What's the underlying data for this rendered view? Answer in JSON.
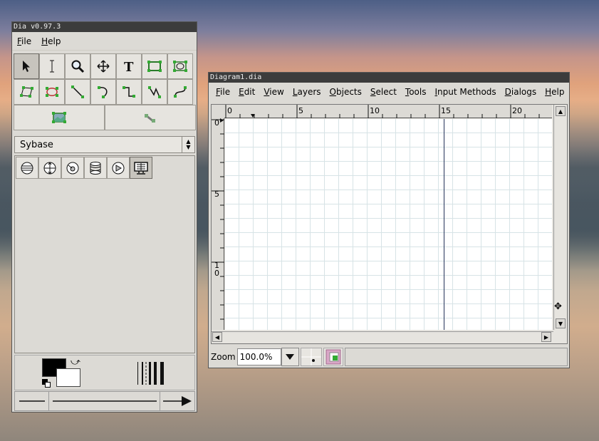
{
  "toolbox": {
    "title": "Dia v0.97.3",
    "menu": [
      "File",
      "Help"
    ],
    "sheet": "Sybase"
  },
  "diagram": {
    "title": "Diagram1.dia",
    "menu": [
      "File",
      "Edit",
      "View",
      "Layers",
      "Objects",
      "Select",
      "Tools",
      "Input Methods",
      "Dialogs",
      "Help"
    ],
    "hruler_labels": [
      "0",
      "5",
      "10",
      "15",
      "20"
    ],
    "vruler_labels": [
      "0",
      "5",
      "1",
      "0"
    ],
    "zoom_label": "Zoom",
    "zoom_value": "100.0%"
  }
}
